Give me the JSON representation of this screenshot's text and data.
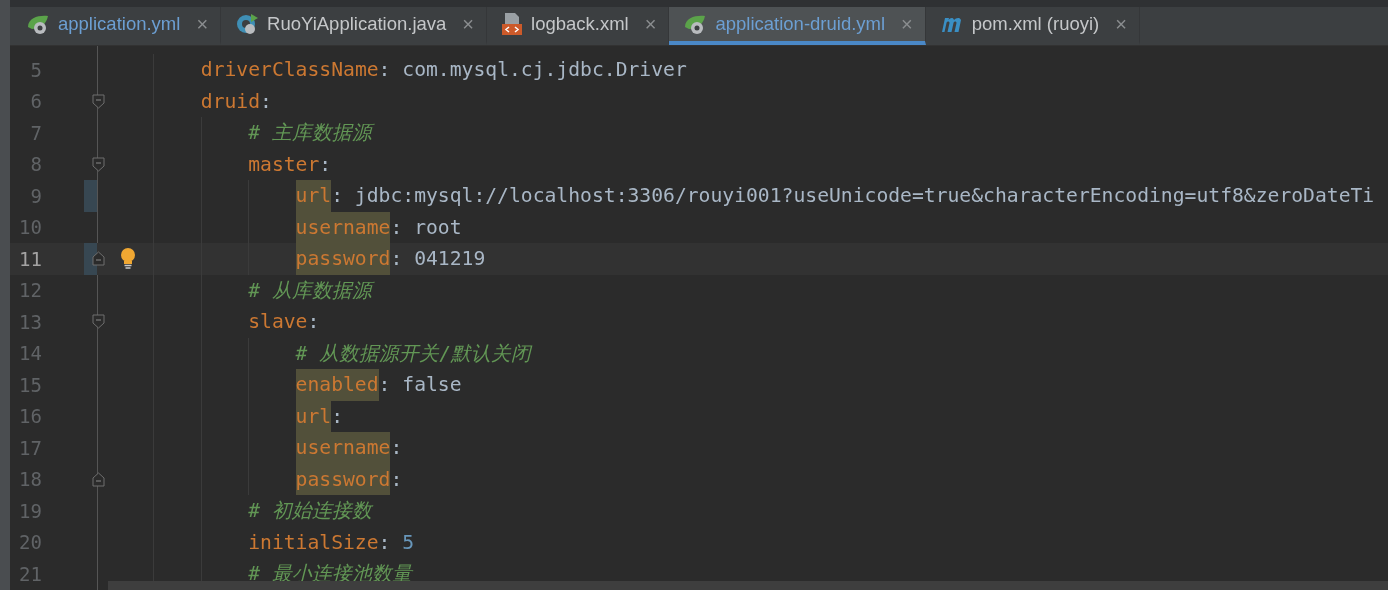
{
  "tabs": [
    {
      "label": "application.yml",
      "kind": "spring",
      "selected": false,
      "modified": true
    },
    {
      "label": "RuoYiApplication.java",
      "kind": "java",
      "selected": false,
      "modified": false
    },
    {
      "label": "logback.xml",
      "kind": "xml",
      "selected": false,
      "modified": false
    },
    {
      "label": "application-druid.yml",
      "kind": "spring",
      "selected": true,
      "modified": true
    },
    {
      "label": "pom.xml (ruoyi)",
      "kind": "maven",
      "selected": false,
      "modified": false
    }
  ],
  "close_glyph": "×",
  "lines": [
    {
      "number": "5",
      "kind": "pair",
      "key": "driverClassName",
      "sep": ":",
      "value": " com.mysql.cj.jdbc.Driver",
      "number_value": false,
      "highlighted": false,
      "current": false,
      "changed": false,
      "fold_start": false,
      "fold_end": false,
      "bulb": false
    },
    {
      "number": "6",
      "kind": "pair",
      "key": "druid",
      "sep": ":",
      "highlighted": false,
      "current": false,
      "changed": false,
      "fold_start": true,
      "fold_end": false,
      "bulb": false,
      "children": [
        {
          "number": "7",
          "kind": "comment",
          "text": "# 主库数据源",
          "current": false,
          "changed": false,
          "fold_start": false,
          "fold_end": false,
          "bulb": false
        },
        {
          "number": "8",
          "kind": "pair",
          "key": "master",
          "sep": ":",
          "highlighted": false,
          "current": false,
          "changed": false,
          "fold_start": true,
          "fold_end": false,
          "bulb": false,
          "children": [
            {
              "number": "9",
              "kind": "pair",
              "key": "url",
              "sep": ":",
              "value": " jdbc:mysql://localhost:3306/rouyi001?useUnicode=true&characterEncoding=utf8&zeroDateTi",
              "number_value": false,
              "highlighted": true,
              "current": false,
              "changed": true,
              "fold_start": false,
              "fold_end": false,
              "bulb": false
            },
            {
              "number": "10",
              "kind": "pair",
              "key": "username",
              "sep": ":",
              "value": " root",
              "number_value": false,
              "highlighted": true,
              "current": false,
              "changed": false,
              "fold_start": false,
              "fold_end": false,
              "bulb": false
            },
            {
              "number": "11",
              "kind": "pair",
              "key": "password",
              "sep": ":",
              "value": " 041219",
              "number_value": false,
              "highlighted": true,
              "current": true,
              "changed": true,
              "fold_start": false,
              "fold_end": true,
              "bulb": true
            }
          ]
        },
        {
          "number": "12",
          "kind": "comment",
          "text": "# 从库数据源",
          "current": false,
          "changed": false,
          "fold_start": false,
          "fold_end": false,
          "bulb": false
        },
        {
          "number": "13",
          "kind": "pair",
          "key": "slave",
          "sep": ":",
          "highlighted": false,
          "current": false,
          "changed": false,
          "fold_start": true,
          "fold_end": false,
          "bulb": false,
          "children": [
            {
              "number": "14",
              "kind": "comment",
              "text": "# 从数据源开关/默认关闭",
              "current": false,
              "changed": false,
              "fold_start": false,
              "fold_end": false,
              "bulb": false
            },
            {
              "number": "15",
              "kind": "pair",
              "key": "enabled",
              "sep": ":",
              "value": " false",
              "number_value": false,
              "highlighted": true,
              "current": false,
              "changed": false,
              "fold_start": false,
              "fold_end": false,
              "bulb": false
            },
            {
              "number": "16",
              "kind": "pair",
              "key": "url",
              "sep": ":",
              "highlighted": true,
              "current": false,
              "changed": false,
              "fold_start": false,
              "fold_end": false,
              "bulb": false
            },
            {
              "number": "17",
              "kind": "pair",
              "key": "username",
              "sep": ":",
              "highlighted": true,
              "current": false,
              "changed": false,
              "fold_start": false,
              "fold_end": false,
              "bulb": false
            },
            {
              "number": "18",
              "kind": "pair",
              "key": "password",
              "sep": ":",
              "highlighted": true,
              "current": false,
              "changed": false,
              "fold_start": false,
              "fold_end": true,
              "bulb": false
            }
          ]
        },
        {
          "number": "19",
          "kind": "comment",
          "text": "# 初始连接数",
          "current": false,
          "changed": false,
          "fold_start": false,
          "fold_end": false,
          "bulb": false
        },
        {
          "number": "20",
          "kind": "pair",
          "key": "initialSize",
          "sep": ":",
          "value": " 5",
          "number_value": true,
          "highlighted": false,
          "current": false,
          "changed": false,
          "fold_start": false,
          "fold_end": false,
          "bulb": false
        },
        {
          "number": "21",
          "kind": "comment",
          "text": "# 最小连接池数量",
          "current": false,
          "changed": false,
          "fold_start": false,
          "fold_end": false,
          "bulb": false
        }
      ]
    }
  ]
}
